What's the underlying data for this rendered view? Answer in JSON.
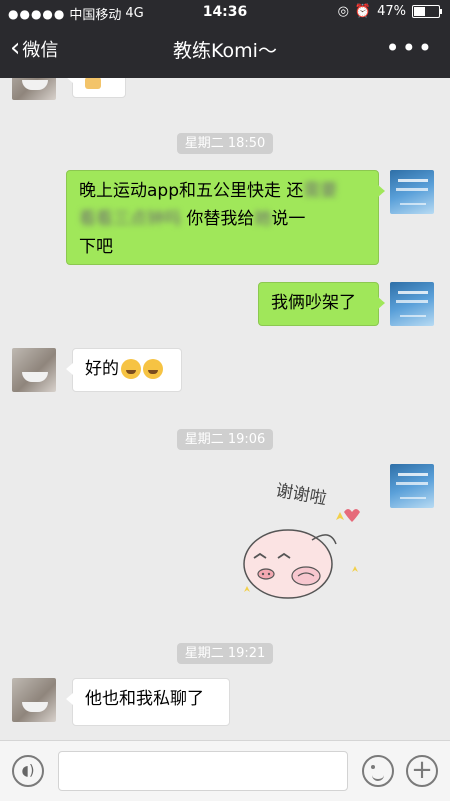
{
  "status_bar": {
    "signal_dots": "●●●●●",
    "carrier": "中国移动",
    "network": "4G",
    "time": "14:36",
    "battery_text": "47%",
    "battery_level": 0.47
  },
  "nav": {
    "back_label": "微信",
    "title": "教练Komi～",
    "more_label": "•••"
  },
  "messages": {
    "t1": "星期二 18:50",
    "m1_part1": "晚上运动app和五公里快走 还",
    "m1_blur1": "需要",
    "m1_blur2": "看看三点钟吗",
    "m1_part2": "你替我给",
    "m1_blur3": "她",
    "m1_part3": "说一",
    "m1_part4": "下吧",
    "m2": "我俩吵架了",
    "m3": "好的",
    "t2": "星期二 19:06",
    "sticker_text": "谢谢啦",
    "t3": "星期二 19:21",
    "m4": "他也和我私聊了"
  },
  "input": {
    "value": "",
    "placeholder": ""
  },
  "colors": {
    "nav_bg": "#2a2a2e",
    "chat_bg": "#ebebeb",
    "my_bubble": "#a0e75a",
    "their_bubble": "#ffffff"
  },
  "icons": {
    "back": "chevron-left-icon",
    "more": "more-icon",
    "voice": "voice-icon",
    "emoji": "emoji-icon",
    "plus": "plus-icon",
    "alarm": "alarm-icon",
    "lock": "rotation-lock-icon"
  }
}
